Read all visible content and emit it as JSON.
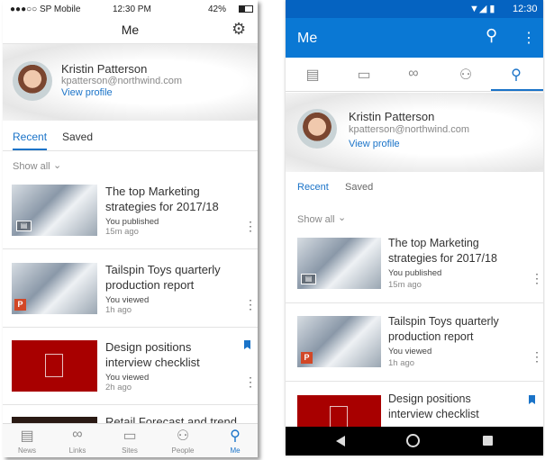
{
  "colors": {
    "accent": "#1a73c8",
    "android_header": "#0a78d4",
    "android_status": "#0563c1",
    "doc_red": "#a80000"
  },
  "ios": {
    "status": {
      "carrier": "●●●○○ SP Mobile",
      "time": "12:30 PM",
      "battery": "42%"
    },
    "header": {
      "title": "Me",
      "settings_icon": "gear-icon"
    },
    "profile": {
      "name": "Kristin Patterson",
      "email": "kpatterson@northwind.com",
      "link": "View profile"
    },
    "tabs": [
      {
        "label": "Recent",
        "active": true
      },
      {
        "label": "Saved"
      }
    ],
    "filter": "Show all",
    "items": [
      {
        "title": "The top Marketing strategies for 2017/18",
        "action": "You published",
        "time": "15m ago",
        "badge": "news-icon"
      },
      {
        "title": "Tailspin Toys quarterly production report",
        "action": "You viewed",
        "time": "1h ago",
        "badge": "powerpoint-icon"
      },
      {
        "title": "Design positions interview checklist",
        "action": "You viewed",
        "time": "2h ago",
        "saved": true
      },
      {
        "title": "Retail Forecast and trend"
      }
    ],
    "nav": [
      {
        "label": "News"
      },
      {
        "label": "Links"
      },
      {
        "label": "Sites"
      },
      {
        "label": "People"
      },
      {
        "label": "Me",
        "active": true
      }
    ]
  },
  "android": {
    "status": {
      "time": "12:30"
    },
    "header": {
      "title": "Me"
    },
    "profile": {
      "name": "Kristin Patterson",
      "email": "kpatterson@northwind.com",
      "link": "View profile"
    },
    "tabs": [
      {
        "label": "Recent",
        "active": true
      },
      {
        "label": "Saved"
      }
    ],
    "filter": "Show all",
    "items": [
      {
        "title": "The top Marketing strategies for 2017/18",
        "action": "You published",
        "time": "15m ago"
      },
      {
        "title": "Tailspin Toys quarterly production report",
        "action": "You viewed",
        "time": "1h ago"
      },
      {
        "title": "Design positions interview checklist",
        "saved": true
      }
    ]
  }
}
